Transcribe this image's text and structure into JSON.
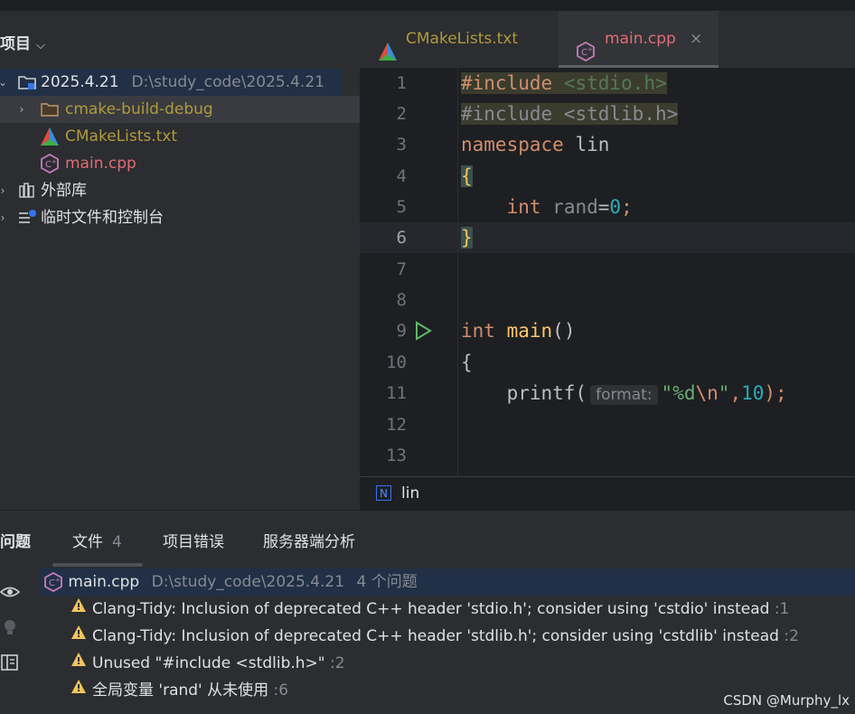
{
  "project_panel": {
    "title": "项目",
    "root": {
      "name": "2025.4.21",
      "path": "D:\\study_code\\2025.4.21"
    },
    "items": [
      {
        "label": "cmake-build-debug"
      },
      {
        "label": "CMakeLists.txt"
      },
      {
        "label": "main.cpp"
      }
    ],
    "external_libs": "外部库",
    "scratches": "临时文件和控制台"
  },
  "editor": {
    "tabs": [
      {
        "label": "CMakeLists.txt"
      },
      {
        "label": "main.cpp",
        "close": "×"
      }
    ],
    "line_numbers": [
      "1",
      "2",
      "3",
      "4",
      "5",
      "6",
      "7",
      "8",
      "9",
      "10",
      "11",
      "12",
      "13"
    ],
    "code": {
      "l1_kw": "#include",
      "l1_hdr": "<stdio.h>",
      "l2_kw": "#include",
      "l2_hdr": "<stdlib.h>",
      "l3_kw": "namespace",
      "l3_id": "lin",
      "l4": "{",
      "l5_kw": "int",
      "l5_id": "rand",
      "l5_eq": "=",
      "l5_num": "0",
      "l5_semi": ";",
      "l6": "}",
      "l9_kw": "int",
      "l9_fn": "main",
      "l9_rest": "()",
      "l10": "{",
      "l11_fn": "printf(",
      "l11_hint": "format:",
      "l11_str1": "\"%d",
      "l11_esc": "\\n",
      "l11_str2": "\"",
      "l11_comma": ",",
      "l11_num": "10",
      "l11_end": ");"
    },
    "breadcrumb": {
      "badge": "N",
      "label": "lin"
    }
  },
  "problems": {
    "tabs": [
      {
        "label": "问题"
      },
      {
        "label": "文件",
        "count": "4"
      },
      {
        "label": "项目错误"
      },
      {
        "label": "服务器端分析"
      }
    ],
    "file_row": {
      "name": "main.cpp",
      "path": "D:\\study_code\\2025.4.21",
      "summary": "4 个问题"
    },
    "issues": [
      {
        "text": "Clang-Tidy: Inclusion of deprecated C++ header 'stdio.h'; consider using 'cstdio' instead",
        "line": ":1"
      },
      {
        "text": "Clang-Tidy: Inclusion of deprecated C++ header 'stdlib.h'; consider using 'cstdlib' instead",
        "line": ":2"
      },
      {
        "text": "Unused \"#include <stdlib.h>\"",
        "line": ":2"
      },
      {
        "text": "全局变量 'rand' 从未使用",
        "line": ":6"
      }
    ]
  },
  "watermark": "CSDN @Murphy_lx",
  "colors": {
    "accent": "#213046",
    "warning": "#f2c55c",
    "keyword": "#cf8e6d",
    "string": "#6aab73",
    "number": "#2aacb8",
    "cpp_file": "#c77dbb"
  }
}
